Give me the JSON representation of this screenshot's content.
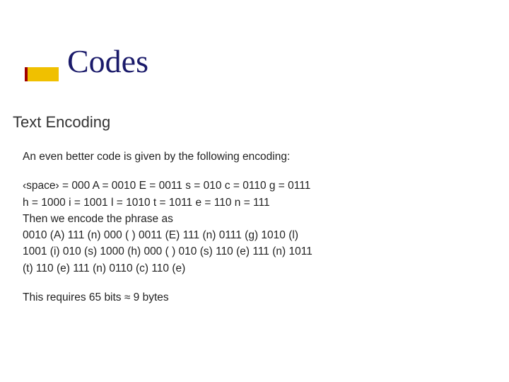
{
  "title": "Codes",
  "subtitle": "Text Encoding",
  "intro": "An even better code is given by the following encoding:",
  "codes_line1": "‹space› = 000   A = 0010   E = 0011   s = 010   c = 0110   g = 0111",
  "codes_line2": "h = 1000 i = 1001   l = 1010   t = 1011   e = 110   n = 111",
  "encode_intro": "Then we encode the phrase as",
  "encoded_line1": "0010 (A)   111 (n)   000 ( )   0011 (E)   111 (n)   0111 (g)   1010 (l)",
  "encoded_line2": "1001 (i) 010 (s)   1000 (h)   000 ( ) 010 (s)   110 (e)   111 (n)   1011",
  "encoded_line3": "(t)   110 (e)   111 (n) 0110 (c)   110 (e)",
  "result": "This requires 65 bits ≈ 9 bytes"
}
